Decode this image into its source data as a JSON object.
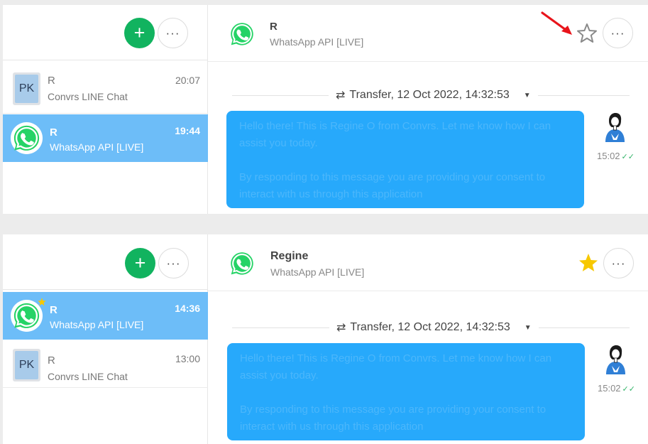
{
  "colors": {
    "accent": "#27a9fb",
    "active_row": "#6dbdf8",
    "add_button": "#11b35f",
    "star_filled": "#f7c800"
  },
  "toolbar": {
    "add_label": "+",
    "more_label": "···"
  },
  "header_more_label": "···",
  "top": {
    "conversations": [
      {
        "avatar": "PK",
        "name": "R",
        "subtitle": "Convrs LINE Chat",
        "time": "20:07",
        "active": false
      },
      {
        "avatar": "whatsapp-icon",
        "name": "R",
        "subtitle": "WhatsApp API [LIVE]",
        "time": "19:44",
        "active": true
      }
    ],
    "header": {
      "name": "R",
      "channel": "WhatsApp API [LIVE]",
      "star": "empty"
    },
    "transfer": {
      "text": "Transfer, 12 Oct 2022, 14:32:53"
    },
    "message": {
      "line1": "Hello there! This is Regine O from Convrs. Let me know how I can assist you today.",
      "line2": "By responding to this message you are providing your consent to interact with us through this application",
      "time": "15:02",
      "status": "✓✓"
    }
  },
  "bottom": {
    "conversations": [
      {
        "avatar": "whatsapp-icon",
        "name": "R",
        "subtitle": "WhatsApp API [LIVE]",
        "time": "14:36",
        "active": true,
        "starred": true
      },
      {
        "avatar": "PK",
        "name": "R",
        "subtitle": "Convrs LINE Chat",
        "time": "13:00",
        "active": false
      }
    ],
    "header": {
      "name": "Regine",
      "channel": "WhatsApp API [LIVE]",
      "star": "filled"
    },
    "transfer": {
      "text": "Transfer, 12 Oct 2022, 14:32:53"
    },
    "message": {
      "line1": "Hello there! This is Regine O from Convrs. Let me know how I can assist you today.",
      "line2": "By responding to this message you are providing your consent to interact with us through this application",
      "time": "15:02",
      "status": "✓✓"
    }
  }
}
